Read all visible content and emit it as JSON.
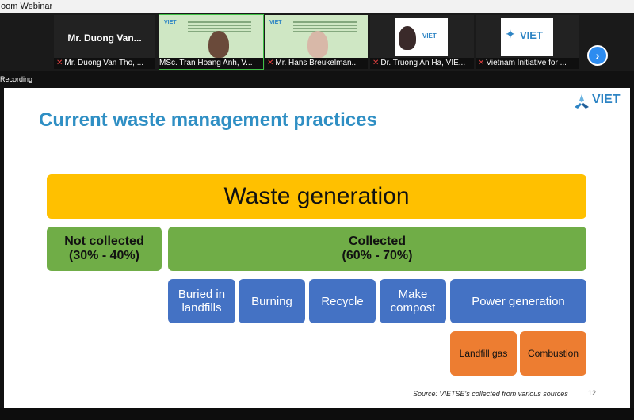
{
  "window": {
    "title": "oom Webinar"
  },
  "gallery": {
    "participants": [
      {
        "display": "Mr. Duong Van...",
        "caption": "Mr. Duong Van Tho, ..."
      },
      {
        "caption": "MSc. Tran Hoang Anh, V..."
      },
      {
        "caption": "Mr. Hans Breukelman..."
      },
      {
        "caption": "Dr. Truong An Ha, VIE..."
      },
      {
        "caption": "Vietnam Initiative for ..."
      }
    ],
    "logo_text": "VIET",
    "next_label": "›"
  },
  "recording": {
    "label": "Recording"
  },
  "slide": {
    "logo_text": "VIET",
    "title": "Current waste management practices",
    "top_box": "Waste generation",
    "not_collected": "Not collected\n(30% - 40%)",
    "collected": "Collected\n(60% - 70%)",
    "methods": [
      "Buried in\nlandfills",
      "Burning",
      "Recycle",
      "Make\ncompost",
      "Power generation"
    ],
    "power_sub": [
      "Landfill gas",
      "Combustion"
    ],
    "source": "Source: VIETSE's collected from various sources",
    "page_number": "12"
  },
  "colors": {
    "title": "#2f8fc4",
    "yellow": "#ffc000",
    "green": "#70ad47",
    "blue": "#4472c4",
    "orange": "#ed7d31"
  }
}
